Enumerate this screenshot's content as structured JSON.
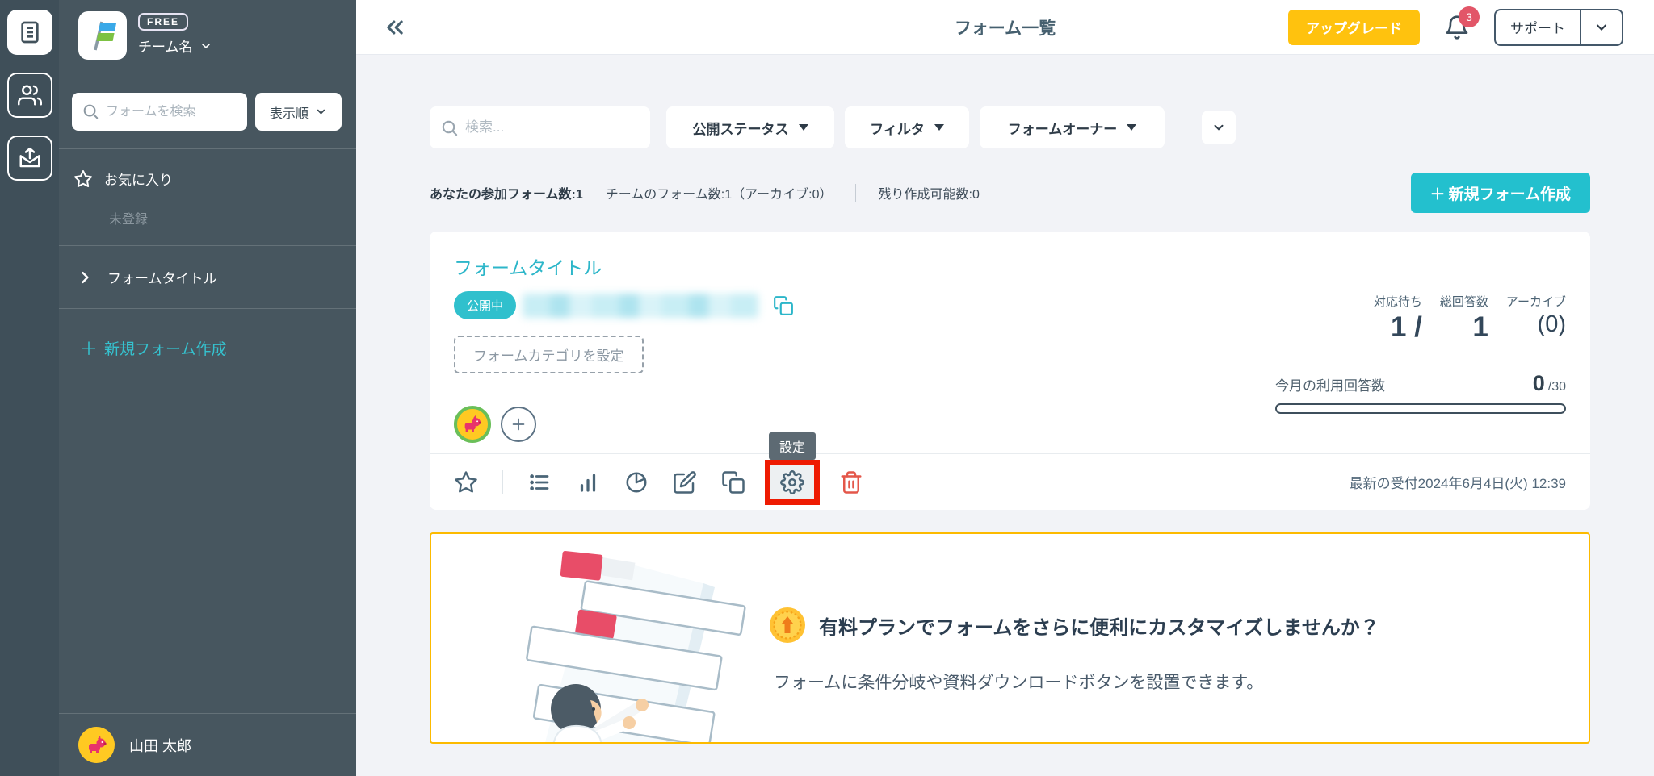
{
  "colors": {
    "accent_teal": "#23c0ce",
    "link_teal": "#2cb6c9",
    "brand_yellow": "#ffc20e",
    "banner_border": "#fcba00",
    "annotation_red": "#ee1b02",
    "danger_red": "#e4574a",
    "sidebar_bg": "#47565f"
  },
  "rail": {
    "icons": [
      "forms-icon",
      "members-icon",
      "inbox-export-icon"
    ]
  },
  "brand": {
    "plan_badge": "FREE",
    "team_name": "チーム名"
  },
  "sidebar": {
    "search_placeholder": "フォームを検索",
    "sort_label": "表示順",
    "favorites_label": "お気に入り",
    "favorites_empty": "未登録",
    "form_item_label": "フォームタイトル",
    "plus_glyph": "＋",
    "new_form_label": "新規フォーム作成",
    "user_name": "山田 太郎"
  },
  "header": {
    "title": "フォーム一覧",
    "upgrade_label": "アップグレード",
    "notification_count": "3",
    "support_label": "サポート"
  },
  "filters": {
    "search_placeholder": "検索...",
    "status_label": "公開ステータス",
    "filter_label": "フィルタ",
    "owner_label": "フォームオーナー"
  },
  "stats": {
    "participating": "あなたの参加フォーム数:1",
    "team": "チームのフォーム数:1（アーカイブ:0）",
    "remaining": "残り作成可能数:0",
    "plus_glyph": "＋",
    "new_form_label": "新規フォーム作成"
  },
  "card": {
    "title": "フォームタイトル",
    "status_badge": "公開中",
    "category_label": "フォームカテゴリを設定",
    "metrics": {
      "waiting_label": "対応待ち",
      "waiting_value": "1 /",
      "total_label": "総回答数",
      "total_value": "1",
      "archive_label": "アーカイブ",
      "archive_value": "(0)"
    },
    "monthly": {
      "label": "今月の利用回答数",
      "used": "0",
      "limit": "/30"
    },
    "settings_tooltip": "設定",
    "latest_response": "最新の受付2024年6月4日(火) 12:39"
  },
  "banner": {
    "heading": "有料プランでフォームをさらに便利にカスタマイズしませんか？",
    "body": "フォームに条件分岐や資料ダウンロードボタンを設置できます。"
  }
}
